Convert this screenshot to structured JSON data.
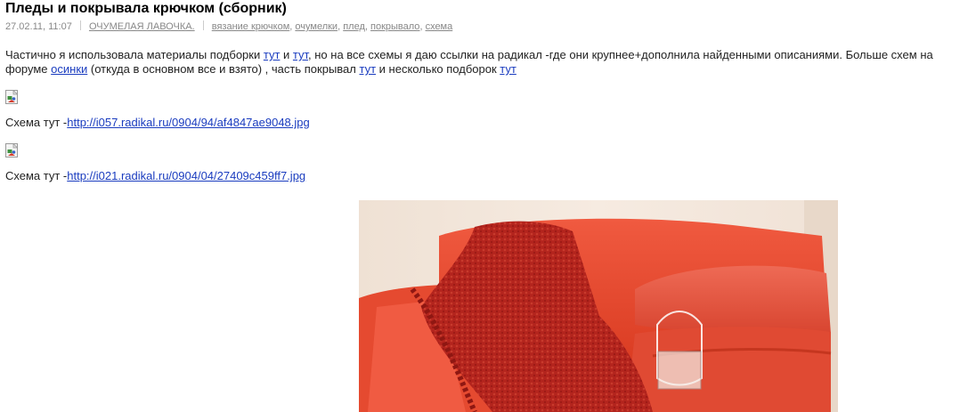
{
  "post": {
    "title": "Пледы и покрывала крючком (сборник)",
    "date": "27.02.11, 11:07",
    "category": "ОЧУМЕЛАЯ ЛАВОЧКА.",
    "tags": [
      "вязание крючком",
      "очумелки",
      "плед",
      "покрывало",
      "схема"
    ],
    "tag_separator": ", "
  },
  "intro": {
    "part1": "Частично я использовала материалы подборки ",
    "link1": "тут",
    "part2": " и ",
    "link2": "тут",
    "part3": ", но на все схемы я даю ссылки на радикал -где они крупнее+дополнила найденными описаниями. Больше схем на форуме ",
    "link3": "осинки",
    "part4": " (откуда в основном все и взято) ,  часть покрывал ",
    "link4": "тут",
    "part5": " и несколько подборок ",
    "link5": "тут"
  },
  "schemes": [
    {
      "prefix": "Схема тут -",
      "url": "http://i057.radikal.ru/0904/94/af4847ae9048.jpg"
    },
    {
      "prefix": "Схема тут -",
      "url": "http://i021.radikal.ru/0904/04/27409c459ff7.jpg"
    }
  ],
  "photo": {
    "icon": "red-sofa-with-crochet-blanket-photo",
    "colors": {
      "sofa": "#e8452e",
      "blanket": "#b8201c",
      "background": "#f3e6d9"
    }
  }
}
